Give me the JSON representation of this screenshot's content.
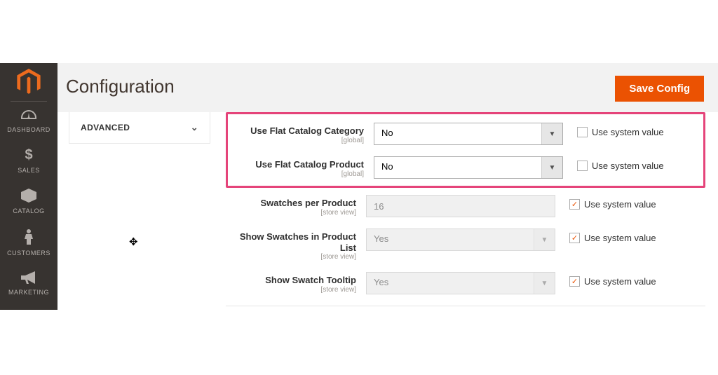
{
  "sidebar": {
    "items": [
      {
        "label": "DASHBOARD"
      },
      {
        "label": "SALES"
      },
      {
        "label": "CATALOG"
      },
      {
        "label": "CUSTOMERS"
      },
      {
        "label": "MARKETING"
      }
    ]
  },
  "header": {
    "title": "Configuration",
    "save_label": "Save Config"
  },
  "config_nav": {
    "section_label": "ADVANCED"
  },
  "fields": {
    "flat_category": {
      "label": "Use Flat Catalog Category",
      "scope": "[global]",
      "value": "No",
      "use_system_label": "Use system value"
    },
    "flat_product": {
      "label": "Use Flat Catalog Product",
      "scope": "[global]",
      "value": "No",
      "use_system_label": "Use system value"
    },
    "swatches_per_product": {
      "label": "Swatches per Product",
      "scope": "[store view]",
      "value": "16",
      "use_system_label": "Use system value"
    },
    "swatches_in_list": {
      "label": "Show Swatches in Product List",
      "scope": "[store view]",
      "value": "Yes",
      "use_system_label": "Use system value"
    },
    "swatch_tooltip": {
      "label": "Show Swatch Tooltip",
      "scope": "[store view]",
      "value": "Yes",
      "use_system_label": "Use system value"
    }
  }
}
